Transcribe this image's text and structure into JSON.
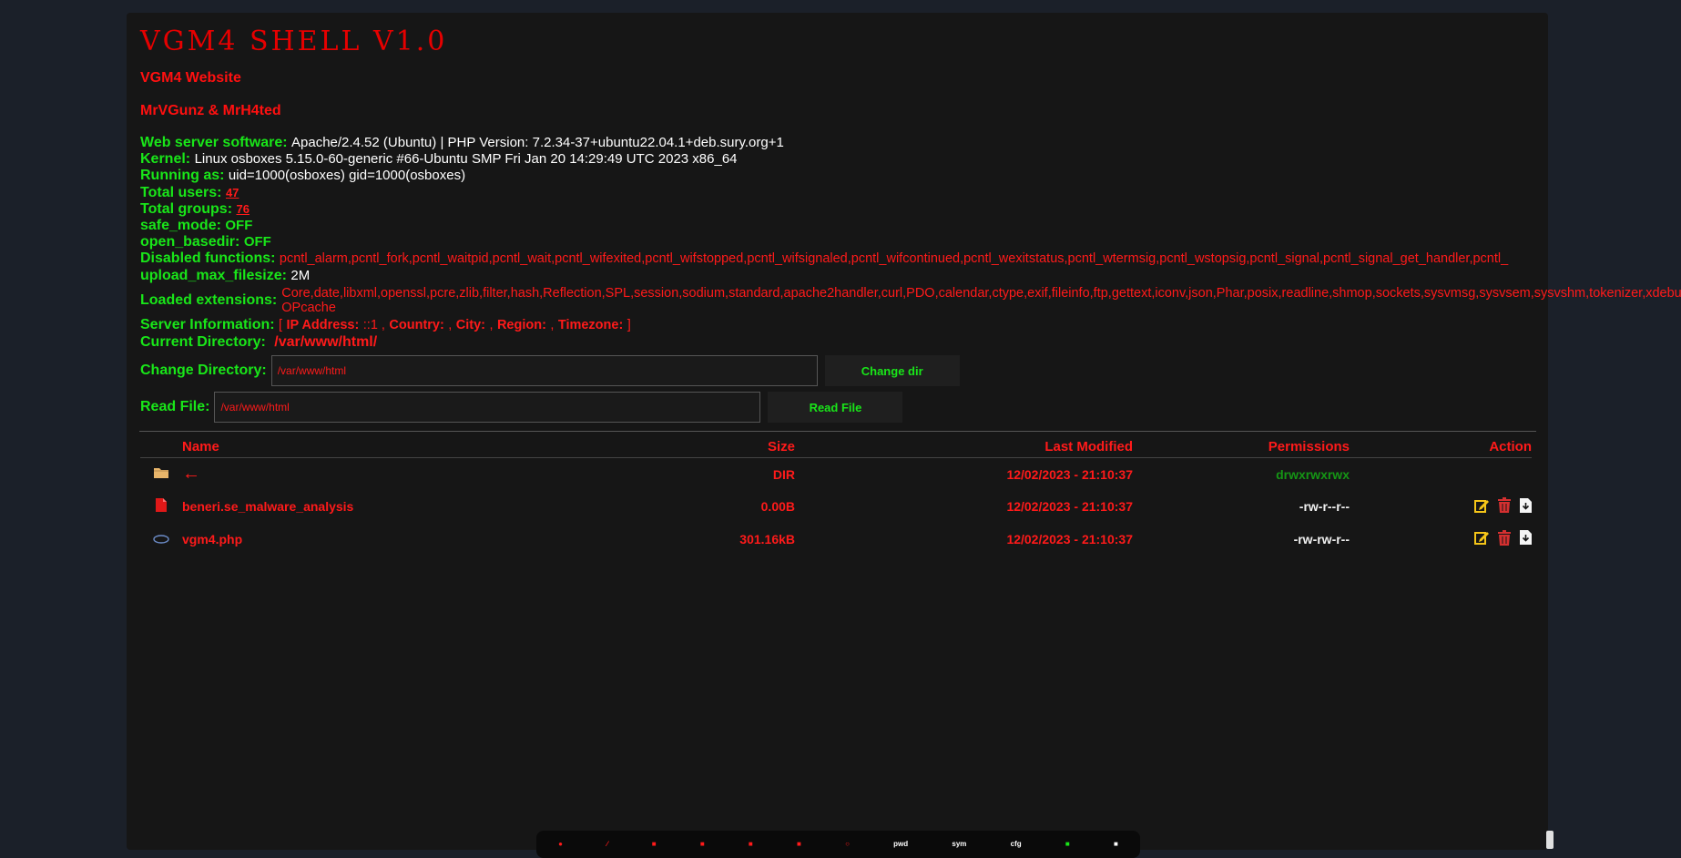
{
  "title": "VGM4 SHELL V1.0",
  "links": {
    "website": "VGM4 Website",
    "authors": "MrVGunz & MrH4ted"
  },
  "info": {
    "web_server": {
      "label": "Web server software:",
      "value": "Apache/2.4.52 (Ubuntu) | PHP Version: 7.2.34-37+ubuntu22.04.1+deb.sury.org+1"
    },
    "kernel": {
      "label": "Kernel:",
      "value": "Linux osboxes 5.15.0-60-generic #66-Ubuntu SMP Fri Jan 20 14:29:49 UTC 2023 x86_64"
    },
    "running_as": {
      "label": "Running as:",
      "value": "uid=1000(osboxes) gid=1000(osboxes)"
    },
    "total_users": {
      "label": "Total users:",
      "value": "47"
    },
    "total_groups": {
      "label": "Total groups:",
      "value": "76"
    },
    "safe_mode": {
      "label": "safe_mode:",
      "value": "OFF"
    },
    "open_basedir": {
      "label": "open_basedir:",
      "value": "OFF"
    },
    "disabled_functions": {
      "label": "Disabled functions:",
      "value": "pcntl_alarm,pcntl_fork,pcntl_waitpid,pcntl_wait,pcntl_wifexited,pcntl_wifstopped,pcntl_wifsignaled,pcntl_wifcontinued,pcntl_wexitstatus,pcntl_wtermsig,pcntl_wstopsig,pcntl_signal,pcntl_signal_get_handler,pcntl_"
    },
    "upload_max_filesize": {
      "label": "upload_max_filesize:",
      "value": "2M"
    },
    "loaded_extensions": {
      "label": "Loaded extensions:",
      "value": "Core,date,libxml,openssl,pcre,zlib,filter,hash,Reflection,SPL,session,sodium,standard,apache2handler,curl,PDO,calendar,ctype,exif,fileinfo,ftp,gettext,iconv,json,Phar,posix,readline,shmop,sockets,sysvmsg,sysvsem,sysvshm,tokenizer,xdebug,Zend OPcache"
    },
    "server_information": {
      "label": "Server Information:",
      "open": "[",
      "ip_label": "IP Address:",
      "ip_value": "::1 ,",
      "country_label": "Country:",
      "country_value": ",",
      "city_label": "City:",
      "city_value": ",",
      "region_label": "Region:",
      "region_value": ",",
      "timezone_label": "Timezone:",
      "close": "]"
    }
  },
  "current_directory": {
    "label": "Current Directory:",
    "path": "/var/www/html/"
  },
  "change_directory": {
    "label": "Change Directory:",
    "value": "/var/www/html",
    "button": "Change dir"
  },
  "read_file": {
    "label": "Read File:",
    "value": "/var/www/html",
    "button": "Read File"
  },
  "table": {
    "headers": {
      "name": "Name",
      "size": "Size",
      "modified": "Last Modified",
      "permissions": "Permissions",
      "action": "Action"
    },
    "rows": [
      {
        "icon": "folder-icon",
        "name": "←",
        "size": "DIR",
        "modified": "12/02/2023 - 21:10:37",
        "permissions": "drwxrwxrwx"
      },
      {
        "icon": "file-icon",
        "name": "beneri.se_malware_analysis",
        "size": "0.00B",
        "modified": "12/02/2023 - 21:10:37",
        "permissions": "-rw-r--r--"
      },
      {
        "icon": "php-icon",
        "name": "vgm4.php",
        "size": "301.16kB",
        "modified": "12/02/2023 - 21:10:37",
        "permissions": "-rw-rw-r--"
      }
    ]
  },
  "bottom_bar": {
    "pwd": "pwd",
    "sym": "sym",
    "cfg": "cfg"
  },
  "colors": {
    "accent_red": "#ff1a1a",
    "label_green": "#19e619",
    "background": "#1b2029",
    "panel": "#161616",
    "edit_icon": "#f5c518",
    "delete_icon": "#d43030"
  }
}
